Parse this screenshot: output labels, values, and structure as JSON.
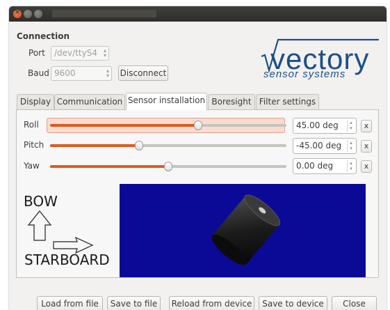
{
  "titlebar": {
    "buttons": [
      "close-icon",
      "minimize-icon",
      "maximize-icon"
    ]
  },
  "connection": {
    "heading": "Connection",
    "port_label": "Port",
    "port_value": "/dev/ttyS4",
    "baud_label": "Baud",
    "baud_value": "9600",
    "disconnect_label": "Disconnect"
  },
  "logo": {
    "brand": "vectory",
    "tagline": "sensor systems",
    "color": "#1d4f86"
  },
  "tabs": [
    {
      "label": "Display"
    },
    {
      "label": "Communication"
    },
    {
      "label": "Sensor installation",
      "active": true
    },
    {
      "label": "Boresight"
    },
    {
      "label": "Filter settings"
    }
  ],
  "sensor_installation": {
    "sliders": [
      {
        "label": "Roll",
        "value": "45.00 deg",
        "level": 0.625,
        "clear": "x"
      },
      {
        "label": "Pitch",
        "value": "-45.00 deg",
        "level": 0.375,
        "clear": "x"
      },
      {
        "label": "Yaw",
        "value": "0.00 deg",
        "level": 0.5,
        "clear": "x"
      }
    ],
    "orientation": {
      "bow_label": "BOW",
      "starboard_label": "STARBOARD"
    },
    "viewport_color": "#0a0a96"
  },
  "footer": {
    "load_from_file": "Load from file",
    "save_to_file": "Save to file",
    "reload_from_device": "Reload from device",
    "save_to_device": "Save to device",
    "close": "Close"
  },
  "colors": {
    "accent": "#e05a1f",
    "window_bg": "#f2f1f0",
    "titlebar_bg": "#3a3935"
  }
}
